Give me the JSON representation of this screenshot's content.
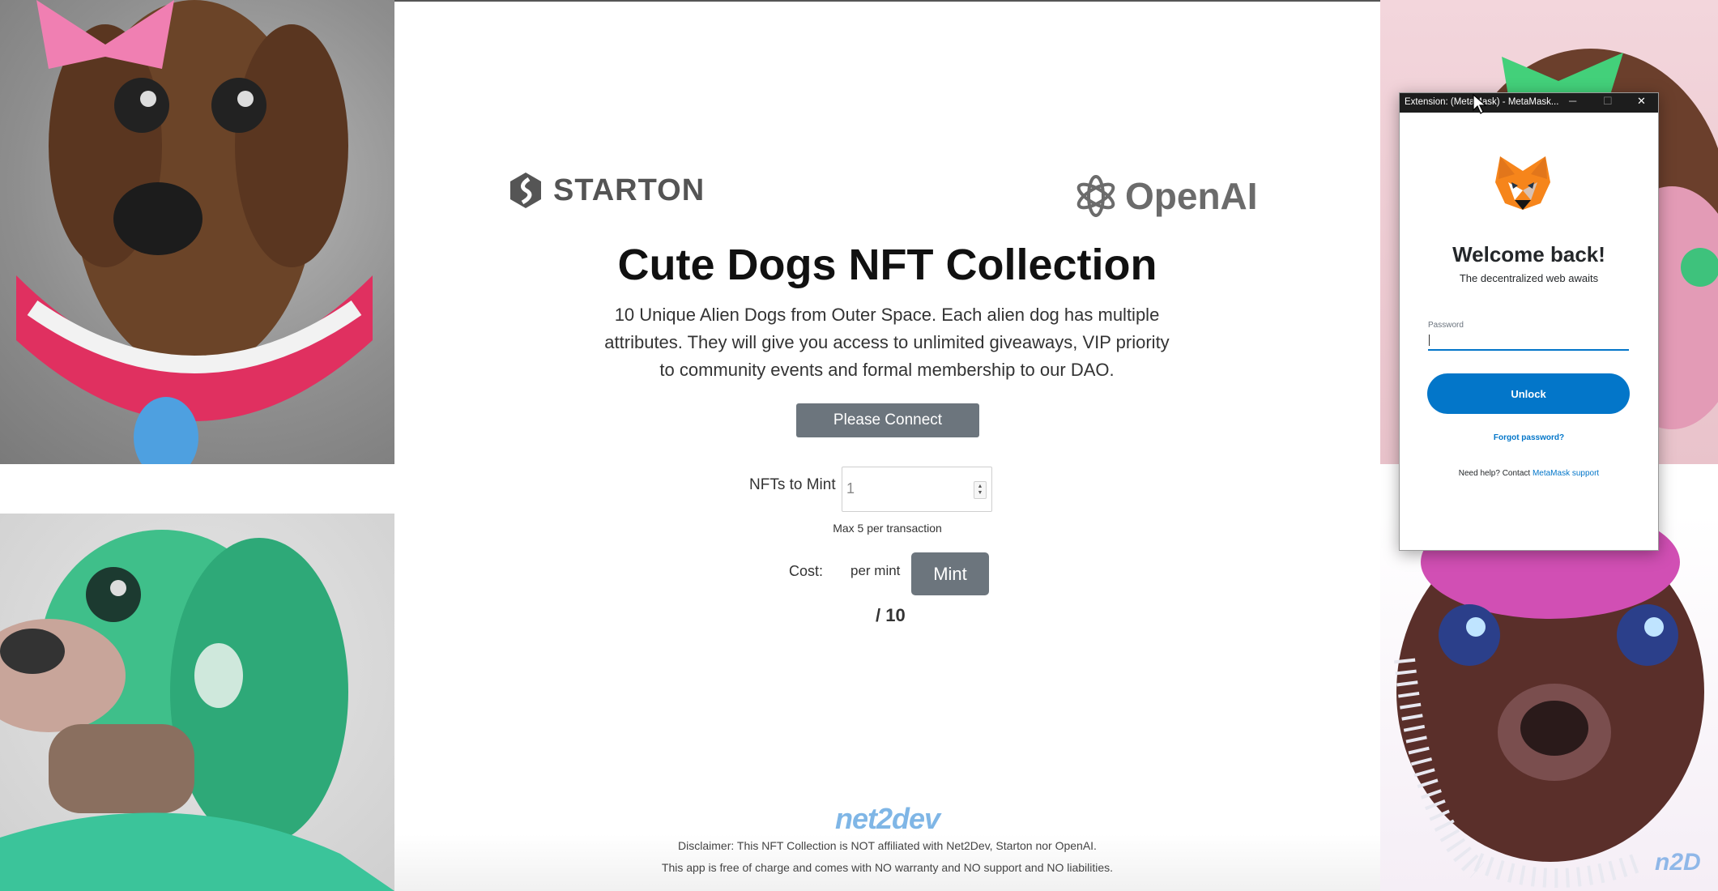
{
  "brand_logos": {
    "starton": "STARTON",
    "openai": "OpenAI"
  },
  "main": {
    "title": "Cute Dogs NFT Collection",
    "description": "10 Unique Alien Dogs from Outer Space. Each alien dog has multiple attributes. They will give you access to unlimited giveaways, VIP priority to community events and formal membership to our DAO.",
    "connect_label": "Please Connect",
    "mint_qty_label": "NFTs to Mint",
    "mint_qty_value": "1",
    "mint_note": "Max 5 per transaction",
    "cost_label": "Cost:",
    "per_mint_label": "per mint",
    "mint_label": "Mint",
    "supply_text": "/ 10"
  },
  "footer": {
    "logo": "net2dev",
    "disclaimer": "Disclaimer: This NFT Collection is NOT affiliated with Net2Dev, Starton nor OpenAI.",
    "notice": "This app is free of charge and comes with NO warranty and NO support and NO liabilities.",
    "watermark": "n2D"
  },
  "metamask": {
    "window_title": "Extension: (MetaMask) - MetaMask...",
    "welcome": "Welcome back!",
    "subtitle": "The decentralized web awaits",
    "password_label": "Password",
    "unlock_label": "Unlock",
    "forgot_label": "Forgot password?",
    "help_prefix": "Need help? Contact",
    "help_link": "MetaMask support"
  },
  "colors": {
    "button_gray": "#6c757d",
    "metamask_blue": "#0376c9",
    "net2dev_blue": "#7fb6e6"
  }
}
